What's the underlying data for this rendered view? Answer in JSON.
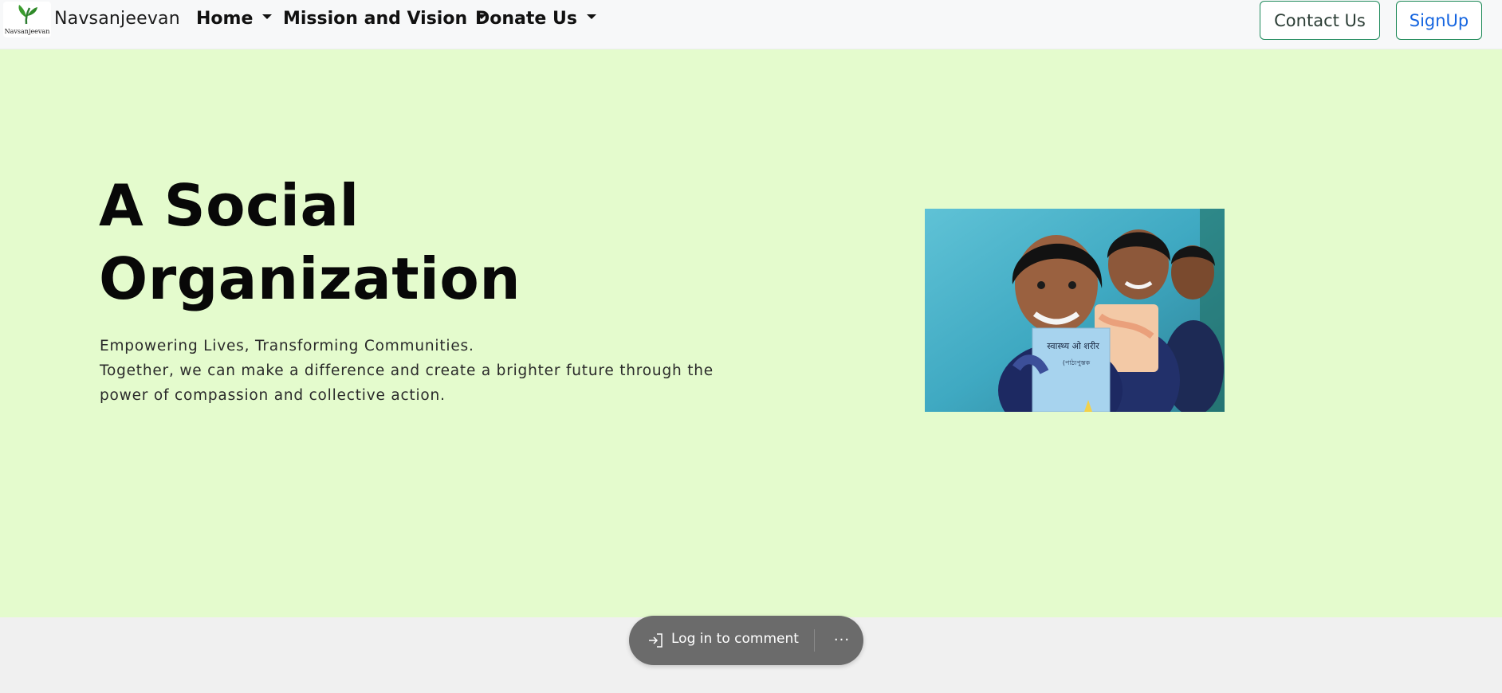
{
  "navbar": {
    "brand": {
      "logo_text": "Navsanjeevan",
      "name": "Navsanjeevan"
    },
    "items": [
      {
        "label": "Home",
        "icon": "caret-down-icon"
      },
      {
        "label": "Mission and Vision",
        "icon": "caret-down-icon"
      },
      {
        "label": "Donate Us",
        "icon": "caret-down-icon"
      }
    ],
    "contact_label": "Contact Us",
    "signup_label": "SignUp"
  },
  "hero": {
    "title_lines": [
      "A Social",
      "Organization"
    ],
    "text_lines": [
      "Empowering Lives, Transforming Communities.",
      "Together, we can make a difference and create a brighter future through the",
      "power of compassion and collective action."
    ],
    "image": {
      "book_text_1": "स्वास्थ्य ओ शरीर",
      "book_text_2": "(পাঠ্যপুস্তক"
    }
  },
  "comment_bar": {
    "login_label": "Log in to comment",
    "more_label": "···"
  },
  "colors": {
    "hero_background": "#e4fbcd",
    "navbar_background": "#f7f8f9",
    "outline_green": "#198754",
    "signup_text": "#1565e0",
    "comment_pill": "#6b6b6b"
  }
}
